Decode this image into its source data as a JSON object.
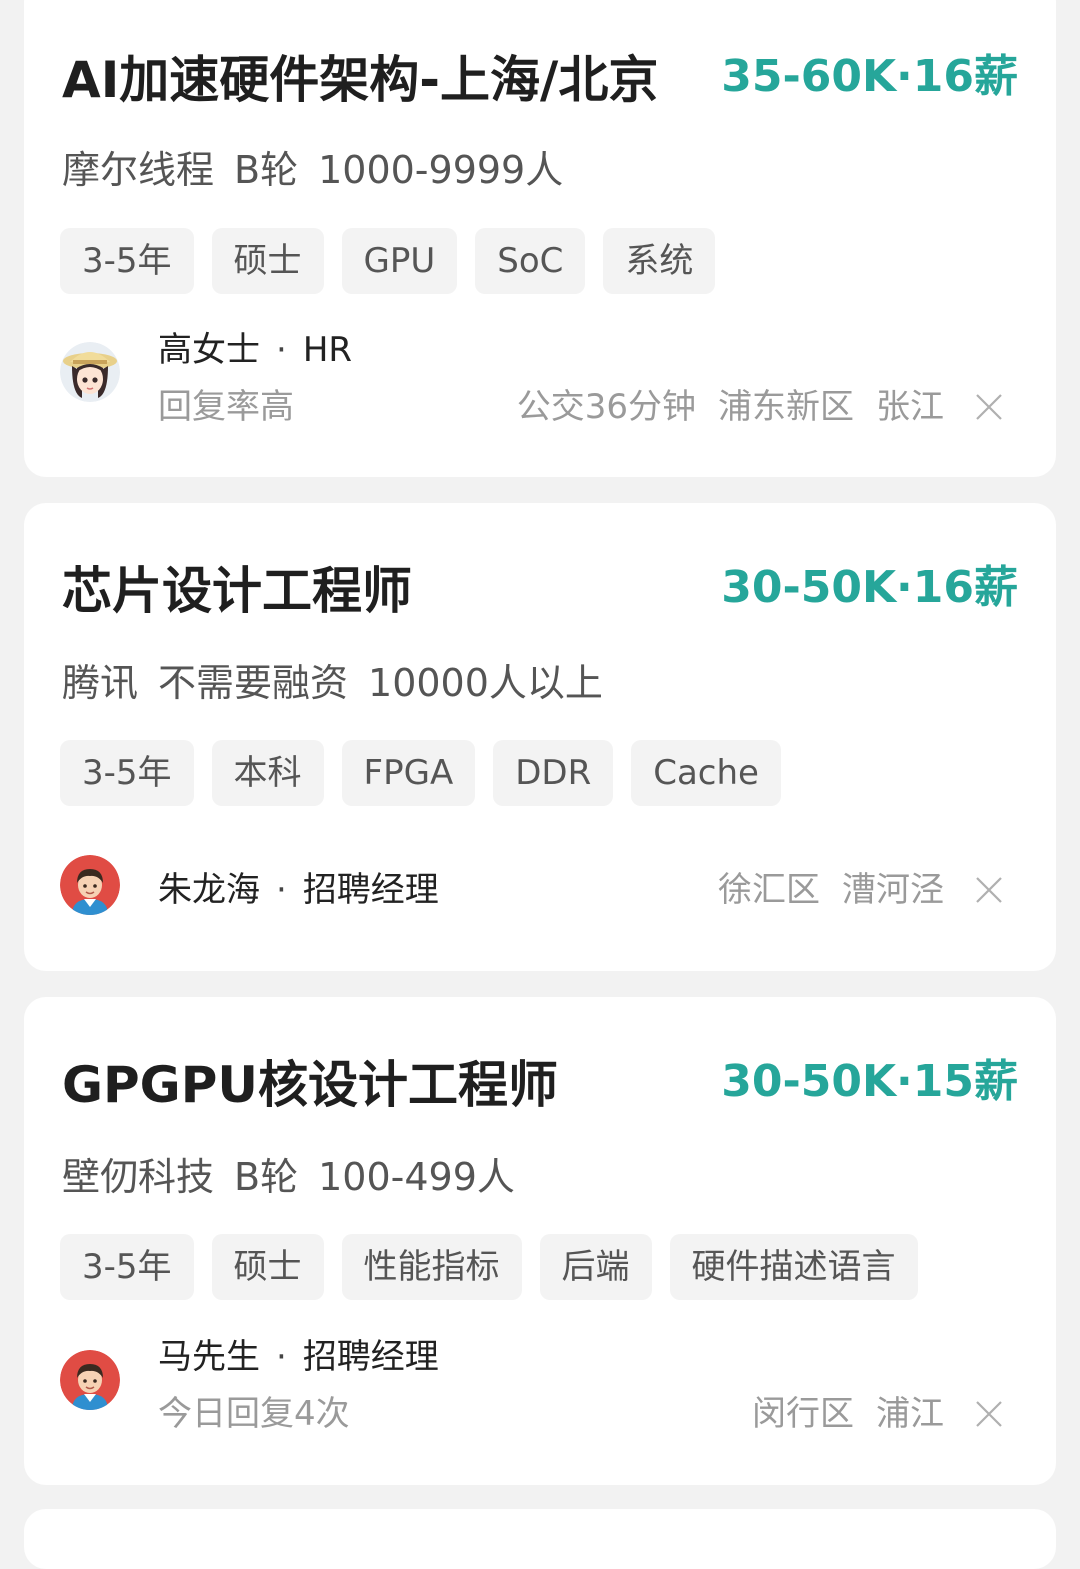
{
  "jobs": [
    {
      "title": "AI加速硬件架构-上海/北京",
      "salary": "35-60K·16薪",
      "company": {
        "name": "摩尔线程",
        "stage": "B轮",
        "size": "1000-9999人"
      },
      "tags": [
        "3-5年",
        "硕士",
        "GPU",
        "SoC",
        "系统"
      ],
      "recruiter": {
        "name": "高女士",
        "role": "HR",
        "avatar": "cartoon-girl-avatar"
      },
      "reply_status": "回复率高",
      "location": [
        "公交36分钟",
        "浦东新区",
        "张江"
      ]
    },
    {
      "title": "芯片设计工程师",
      "salary": "30-50K·16薪",
      "company": {
        "name": "腾讯",
        "stage": "不需要融资",
        "size": "10000人以上"
      },
      "tags": [
        "3-5年",
        "本科",
        "FPGA",
        "DDR",
        "Cache"
      ],
      "recruiter": {
        "name": "朱龙海",
        "role": "招聘经理",
        "avatar": "man-avatar"
      },
      "reply_status": "",
      "location": [
        "徐汇区",
        "漕河泾"
      ]
    },
    {
      "title": "GPGPU核设计工程师",
      "salary": "30-50K·15薪",
      "company": {
        "name": "壁仞科技",
        "stage": "B轮",
        "size": "100-499人"
      },
      "tags": [
        "3-5年",
        "硕士",
        "性能指标",
        "后端",
        "硬件描述语言"
      ],
      "recruiter": {
        "name": "马先生",
        "role": "招聘经理",
        "avatar": "man-avatar"
      },
      "reply_status": "今日回复4次",
      "location": [
        "闵行区",
        "浦江"
      ]
    }
  ],
  "separator": "·",
  "colors": {
    "salary": "#26a69a",
    "background": "#f2f2f2",
    "card": "#ffffff",
    "tag_bg": "#f3f3f3"
  }
}
